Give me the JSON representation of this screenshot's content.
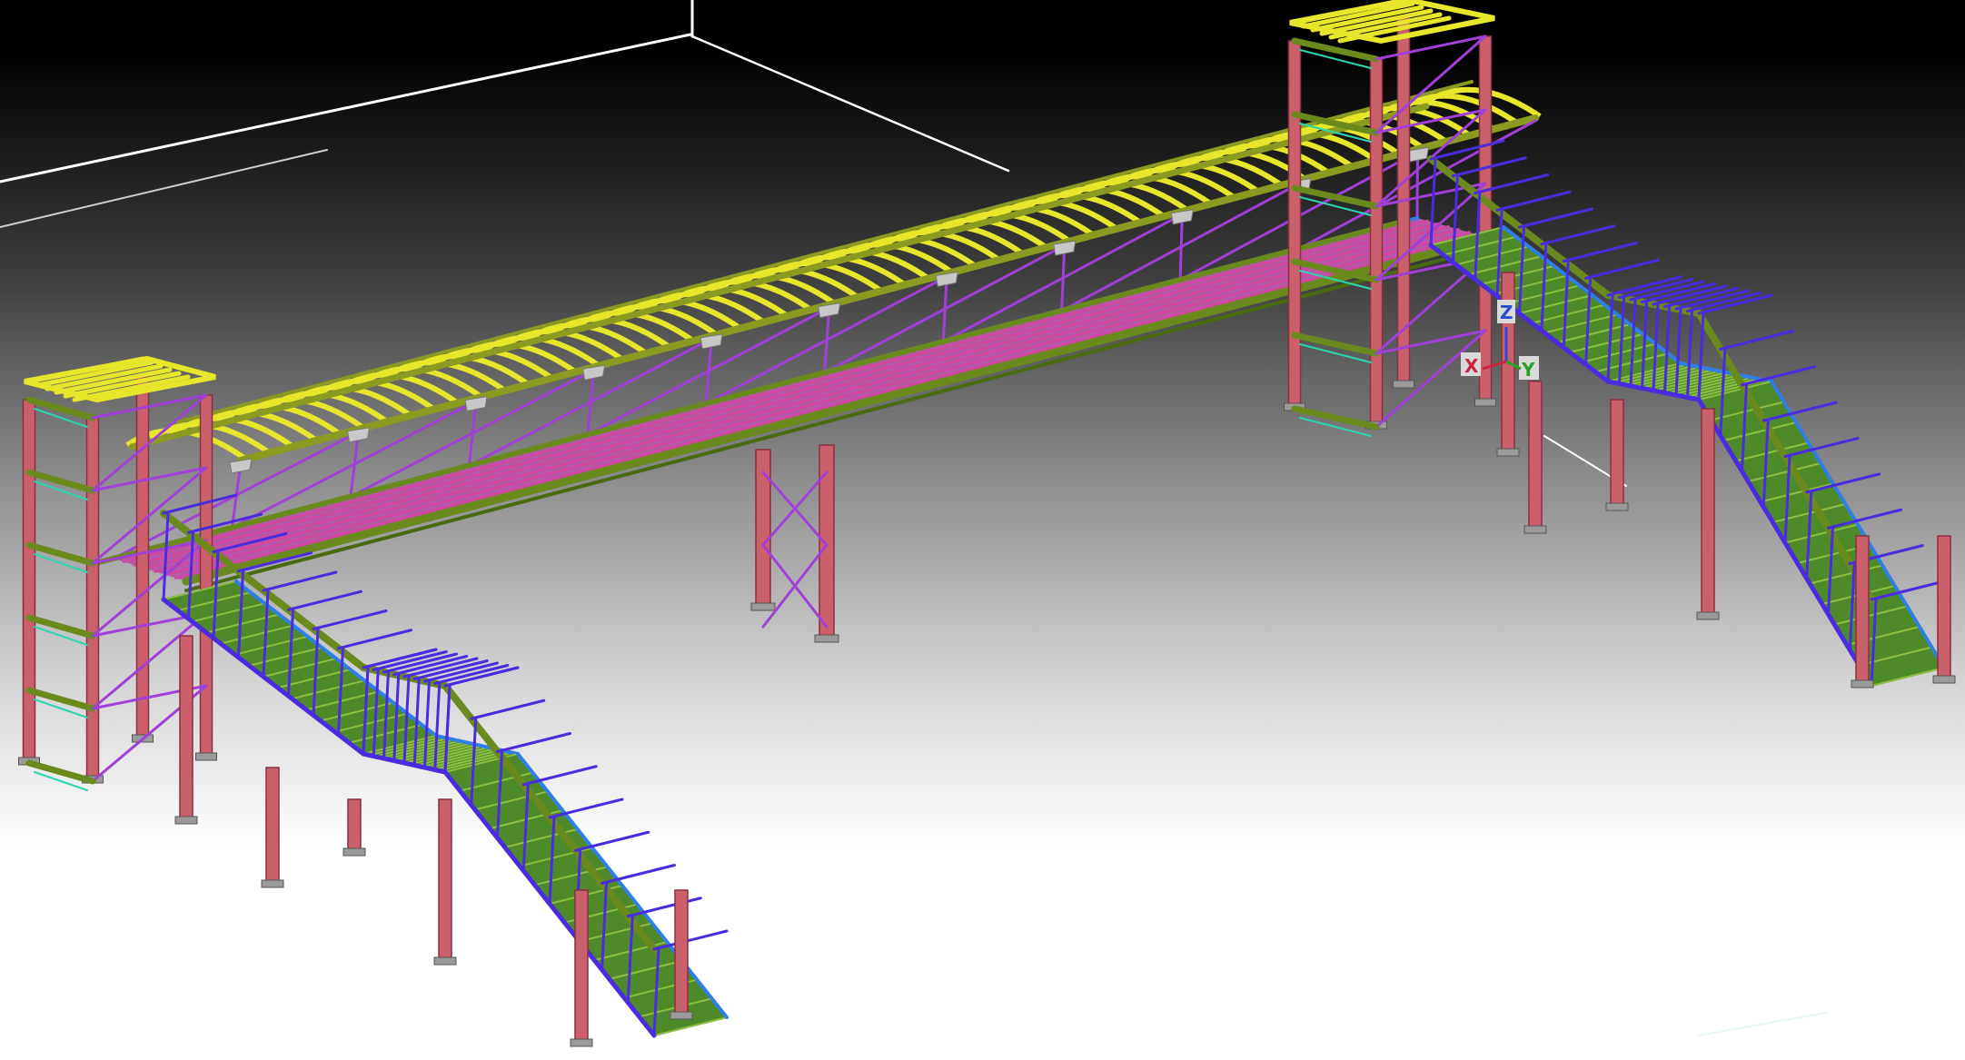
{
  "viewport": {
    "background": {
      "top": "#000000",
      "bottom": "#ffffff"
    }
  },
  "triad": {
    "x_label": "X",
    "y_label": "Y",
    "z_label": "Z"
  },
  "colors": {
    "column": "#c9606b",
    "column_edge": "#8a3040",
    "deck_edge": "#6b8a1e",
    "deck_joist": "#d247a0",
    "stair_tread": "#5a8f2d",
    "stair_edge": "#3a5f1a",
    "roof_rafter": "#e6e62a",
    "roof_purlin": "#8b9a20",
    "x_brace": "#a040d8",
    "handrail": "#4a2be0",
    "aux_beam": "#2ad6b0",
    "grid_line": "#ffffff"
  }
}
